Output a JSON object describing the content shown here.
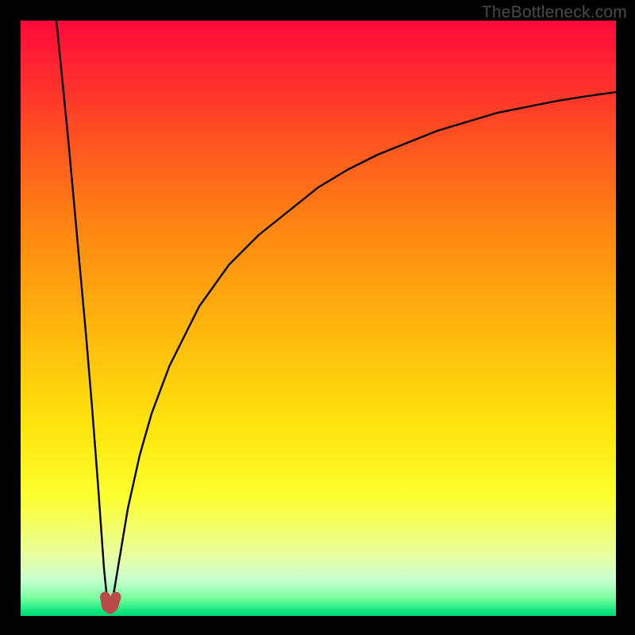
{
  "watermark": {
    "text": "TheBottleneck.com"
  },
  "chart_data": {
    "type": "line",
    "title": "",
    "xlabel": "",
    "ylabel": "",
    "xlim": [
      0,
      100
    ],
    "ylim": [
      0,
      100
    ],
    "grid": false,
    "legend": false,
    "background_gradient_stops": [
      {
        "pct": 0,
        "color": "#ff0a3a"
      },
      {
        "pct": 22,
        "color": "#ff5a1e"
      },
      {
        "pct": 52,
        "color": "#ffb70c"
      },
      {
        "pct": 80,
        "color": "#fbff2e"
      },
      {
        "pct": 97,
        "color": "#7affa0"
      },
      {
        "pct": 100,
        "color": "#00d877"
      }
    ],
    "series": [
      {
        "name": "bottleneck-left",
        "comment": "Steep descending arm from upper-left down to the minimum at x≈15. y as % of vertical axis (0 bottom, 100 top).",
        "x": [
          6,
          7,
          8,
          9,
          10,
          11,
          12,
          13,
          13.5,
          14,
          14.4,
          14.7,
          15
        ],
        "values": [
          100,
          90,
          80,
          69,
          58,
          47,
          35,
          22,
          15,
          8,
          4,
          2,
          1.5
        ]
      },
      {
        "name": "bottleneck-right",
        "comment": "Rising arm from minimum, concave, approaching ~88 at right edge.",
        "x": [
          15,
          15.5,
          16,
          17,
          18,
          20,
          22,
          25,
          30,
          35,
          40,
          45,
          50,
          55,
          60,
          65,
          70,
          75,
          80,
          85,
          90,
          95,
          100
        ],
        "values": [
          1.5,
          3,
          6,
          12,
          18,
          27,
          34,
          42,
          52,
          59,
          64,
          68,
          72,
          75,
          77.5,
          79.5,
          81.5,
          83,
          84.5,
          85.5,
          86.5,
          87.3,
          88
        ]
      },
      {
        "name": "minimum-marker",
        "comment": "Small red-brown U marker at curve minimum around x=14.3..16",
        "x": [
          14.2,
          14.5,
          15,
          15.5,
          16.0
        ],
        "values": [
          3.2,
          1.6,
          1.2,
          1.6,
          3.2
        ],
        "style": {
          "stroke": "#b94a48",
          "stroke_width_px": 13,
          "linecap": "round"
        }
      }
    ]
  }
}
